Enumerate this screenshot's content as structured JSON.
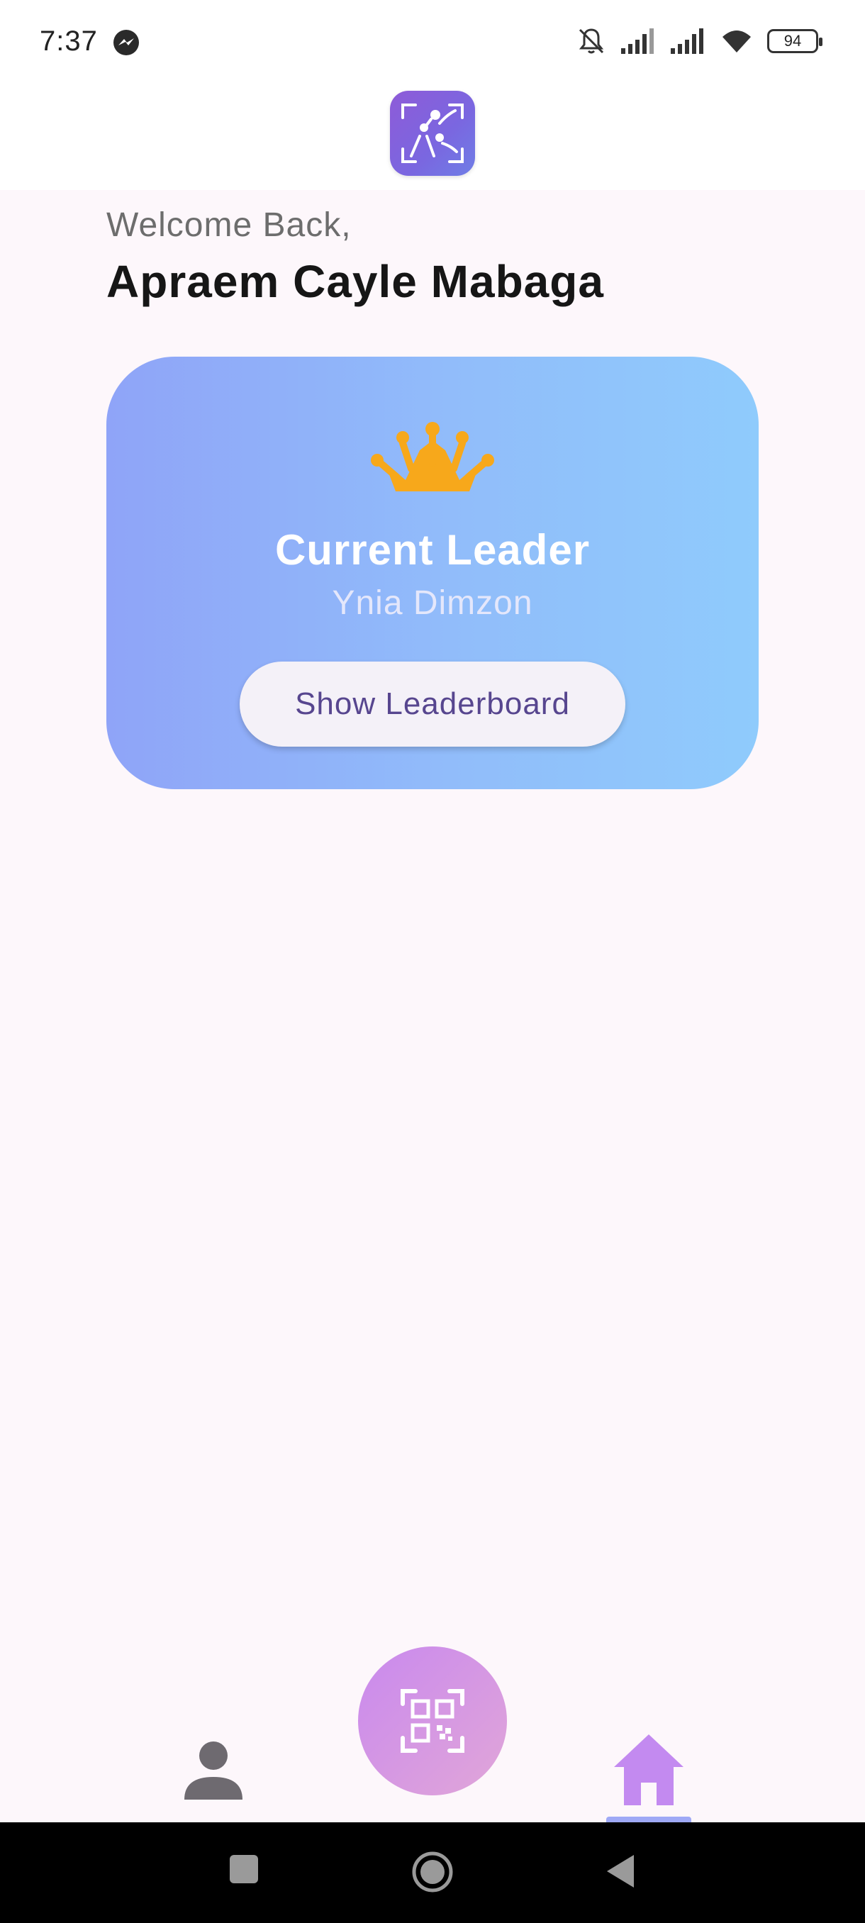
{
  "status_bar": {
    "time": "7:37",
    "battery": "94",
    "icons": [
      "messenger-icon",
      "bell-off-icon",
      "signal-icon",
      "signal-icon",
      "wifi-icon",
      "battery-icon"
    ]
  },
  "header": {
    "logo": "app-logo"
  },
  "greeting": {
    "welcome": "Welcome Back,",
    "name": "Apraem Cayle Mabaga"
  },
  "leader_card": {
    "icon": "crown-icon",
    "title": "Current Leader",
    "leader_name": "Ynia Dimzon",
    "button_label": "Show Leaderboard"
  },
  "bottom_nav": {
    "items": [
      {
        "icon": "profile-icon",
        "active": false
      },
      {
        "icon": "qr-scan-icon",
        "active": false
      },
      {
        "icon": "home-icon",
        "active": true
      }
    ]
  },
  "colors": {
    "background": "#fdf7fb",
    "card_gradient_start": "#8fa4f8",
    "card_gradient_end": "#8fcbfc",
    "crown": "#f7a81b",
    "button_text": "#57468f",
    "home_active": "#c38af0",
    "scan_gradient_start": "#c989ee",
    "scan_gradient_end": "#e1a6d8"
  }
}
